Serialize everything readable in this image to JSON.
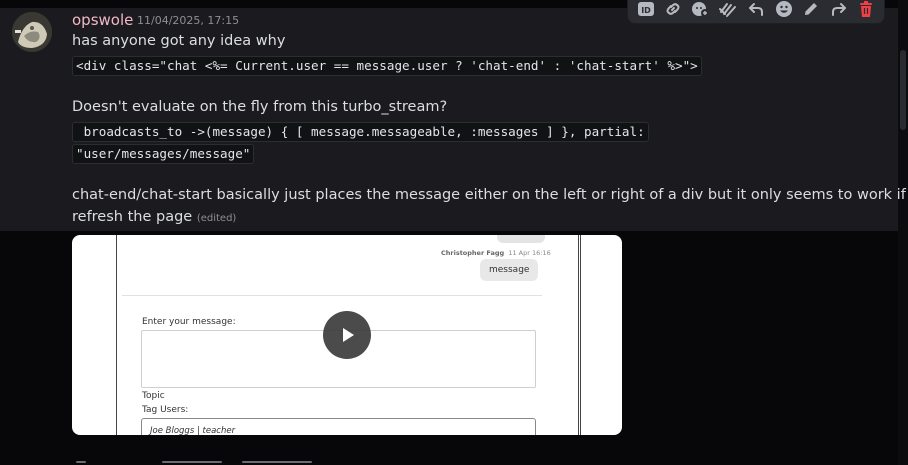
{
  "message": {
    "author": "opswole",
    "timestamp": "11/04/2025, 17:15",
    "line1": "has anyone got any idea why",
    "code1": "<div class=\"chat <%= Current.user == message.user ? 'chat-end' : 'chat-start' %>\">",
    "line2": "Doesn't evaluate on the fly from this turbo_stream?",
    "code2a": " broadcasts_to ->(message) { [ message.messageable, :messages ] }, partial:",
    "code2b": "\"user/messages/message\"",
    "line3a": "chat-end/chat-start basically just places the message either on the left or right of a div but it only seems to work if I",
    "line3b": "refresh the page",
    "edited": "(edited)"
  },
  "toolbar": {
    "buttons": [
      {
        "name": "copy-id-icon"
      },
      {
        "name": "copy-link-icon"
      },
      {
        "name": "add-reaction-icon"
      },
      {
        "name": "apps-icon"
      },
      {
        "name": "reply-icon"
      },
      {
        "name": "emoji-icon"
      },
      {
        "name": "edit-icon"
      },
      {
        "name": "forward-icon"
      },
      {
        "name": "delete-icon"
      }
    ],
    "danger_color": "#f23f43"
  },
  "video": {
    "sender": "Christopher Fagg",
    "sent_time": "11 Apr 16:16",
    "bubble_text": "message",
    "label_message": "Enter your message:",
    "label_topic": "Topic",
    "label_tag": "Tag Users:",
    "tag_value": "Joe Bloggs | teacher"
  },
  "colors": {
    "username": "#f2b8c6",
    "background": "#1b1b1f"
  }
}
